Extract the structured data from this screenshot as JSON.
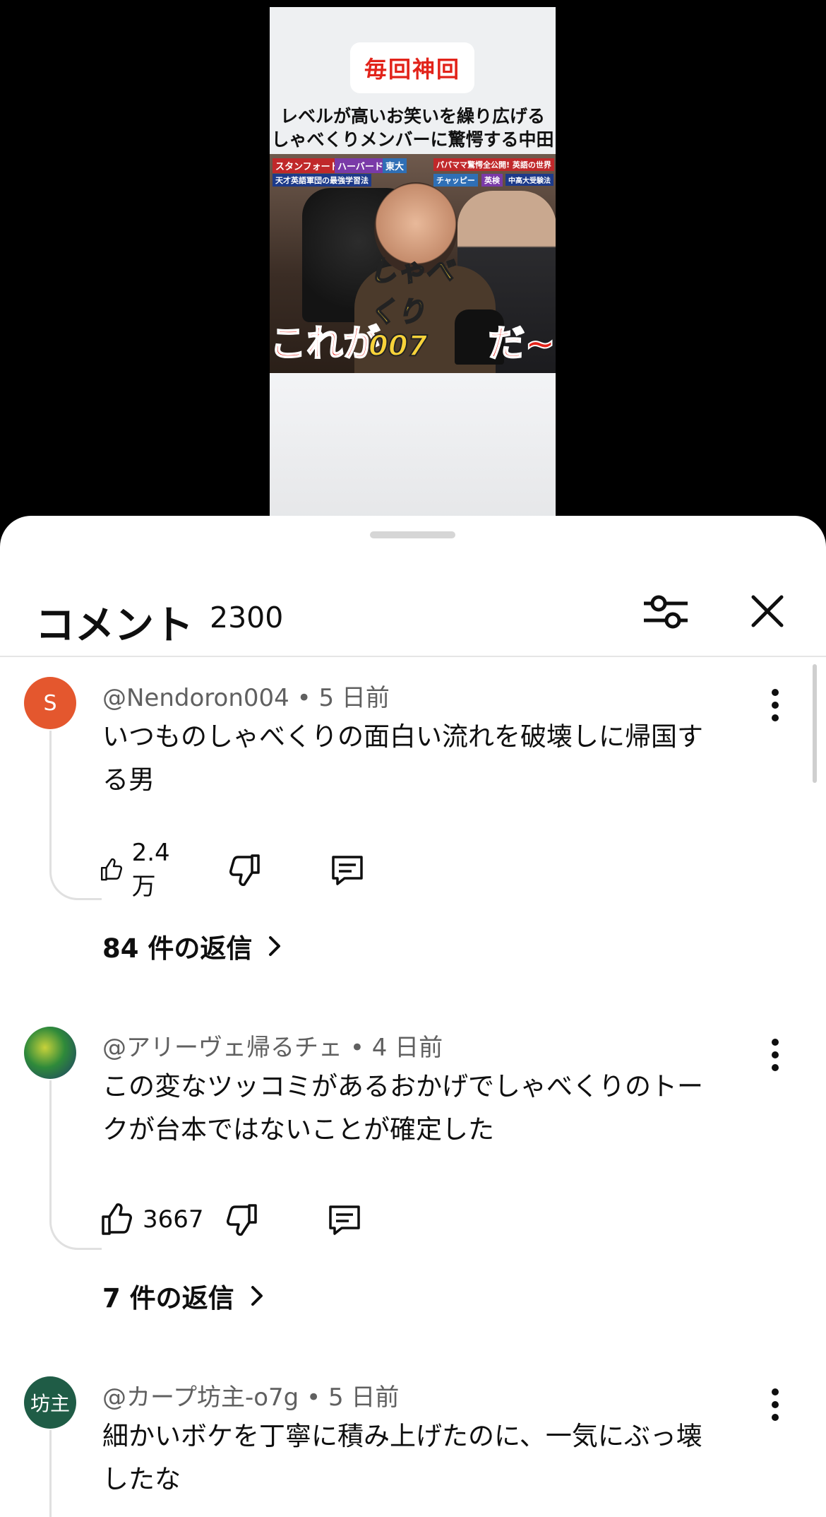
{
  "video": {
    "badge": "毎回神回",
    "caption_line1": "レベルが高いお笑いを繰り広げる",
    "caption_line2": "しゃべくりメンバーに驚愕する中田",
    "tags": [
      "スタンフォード",
      "ハーバード",
      "東大",
      "天才英語軍団の最強学習法",
      "パパママ驚愕全公開! 英語の世界",
      "チャッピー",
      "英検",
      "中高大受験法"
    ],
    "overlay_left": "これが",
    "overlay_logo": "しゃべくり007",
    "overlay_right": "だ~"
  },
  "comments_panel": {
    "title": "コメント",
    "count": "2300",
    "filter_icon": "sliders-icon",
    "close_icon": "close-icon"
  },
  "comments": [
    {
      "author": "@Nendoron004",
      "time": "5 日前",
      "avatar_letter": "S",
      "avatar_color": "#e4572e",
      "line1": "いつものしゃべくりの面白い流れを破壊しに帰国す",
      "line2": "る男",
      "likes": "2.4 万",
      "replies": "84 件の返信"
    },
    {
      "author": "@アリーヴェ帰るチェ",
      "time": "4 日前",
      "avatar_letter": "",
      "avatar_color": "#2f6b3a",
      "line1": "この変なツッコミがあるおかげでしゃべくりのトー",
      "line2": "クが台本ではないことが確定した",
      "likes": "3667",
      "replies": "7 件の返信"
    },
    {
      "author": "@カープ坊主-o7g",
      "time": "5 日前",
      "avatar_letter": "坊主",
      "avatar_color": "#1f5c46",
      "line1": "細かいボケを丁寧に積み上げたのに、一気にぶっ壊",
      "line2": "したな"
    }
  ],
  "separator": "•"
}
